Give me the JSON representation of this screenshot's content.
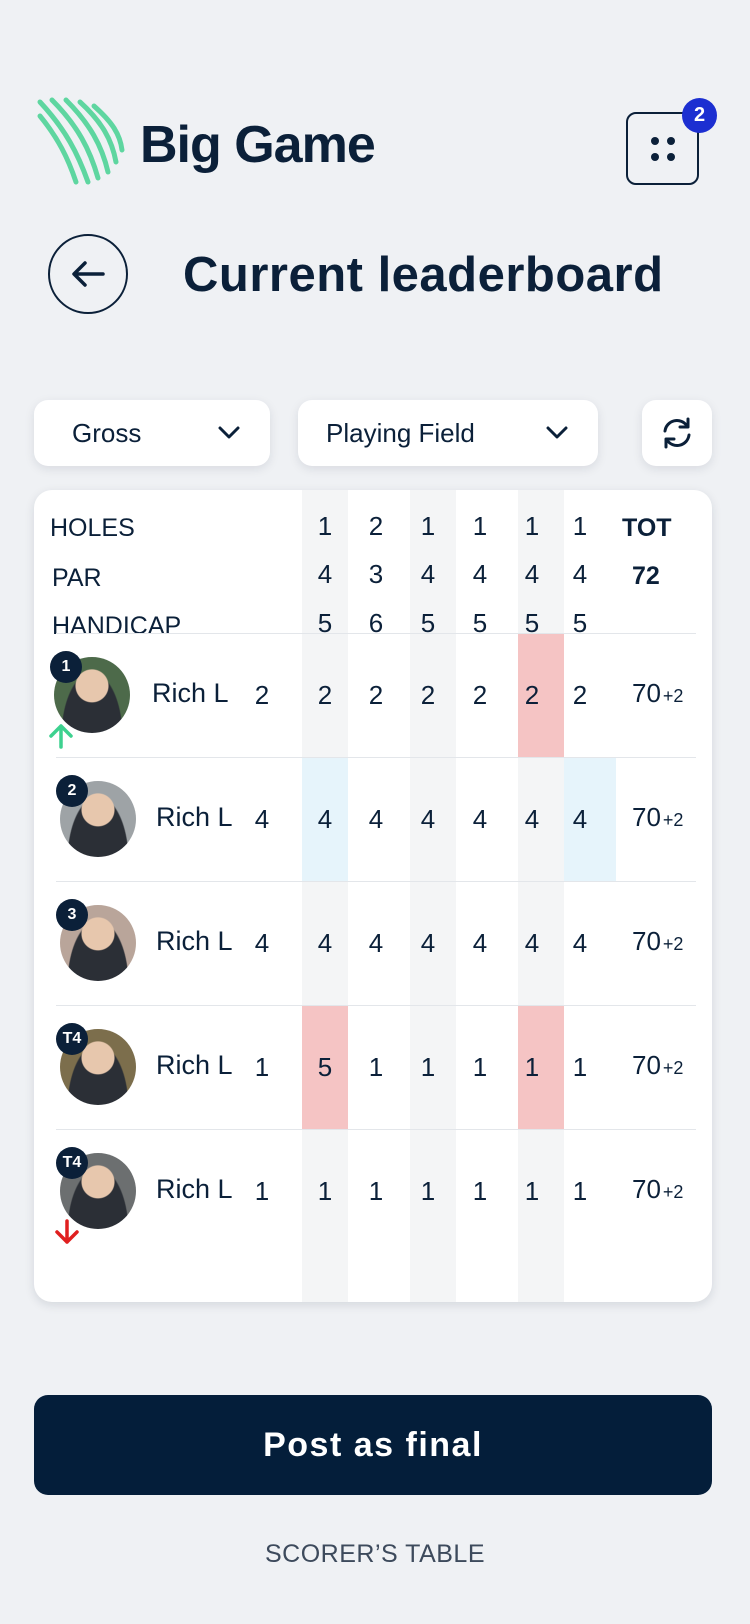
{
  "brand": {
    "name": "Big Game",
    "accent": "#5ed6a0"
  },
  "header": {
    "notification_count": "2",
    "title": "Current leaderboard"
  },
  "filters": {
    "score_type": "Gross",
    "scope": "Playing Field"
  },
  "scorecard": {
    "labels": {
      "holes": "HOLES",
      "par": "PAR",
      "handicap": "HANDICAP",
      "total": "TOT"
    },
    "holes": [
      "1",
      "2",
      "1",
      "1",
      "1",
      "1"
    ],
    "par": [
      "4",
      "3",
      "4",
      "4",
      "4",
      "4"
    ],
    "handicap": [
      "5",
      "6",
      "5",
      "5",
      "5",
      "5"
    ],
    "par_total": "72",
    "players": [
      {
        "rank": "1",
        "name": "Rich L",
        "hcp": "2",
        "scores": [
          "2",
          "2",
          "2",
          "2",
          "2",
          "2"
        ],
        "total": "70",
        "diff": "+2",
        "trend": "up"
      },
      {
        "rank": "2",
        "name": "Rich L",
        "hcp": "4",
        "scores": [
          "4",
          "4",
          "4",
          "4",
          "4",
          "4"
        ],
        "total": "70",
        "diff": "+2",
        "trend": "none"
      },
      {
        "rank": "3",
        "name": "Rich L",
        "hcp": "4",
        "scores": [
          "4",
          "4",
          "4",
          "4",
          "4",
          "4"
        ],
        "total": "70",
        "diff": "+2",
        "trend": "none"
      },
      {
        "rank": "T4",
        "name": "Rich L",
        "hcp": "1",
        "scores": [
          "5",
          "1",
          "1",
          "1",
          "1",
          "1"
        ],
        "total": "70",
        "diff": "+2",
        "trend": "none"
      },
      {
        "rank": "T4",
        "name": "Rich L",
        "hcp": "1",
        "scores": [
          "1",
          "1",
          "1",
          "1",
          "1",
          "1"
        ],
        "total": "70",
        "diff": "+2",
        "trend": "down"
      }
    ]
  },
  "actions": {
    "post_final": "Post as final",
    "scorer_table": "SCORER’S TABLE"
  },
  "colors": {
    "highlight_red": "#f5c4c4",
    "highlight_blue": "#e6f4fb",
    "column_gray": "#f4f5f6",
    "trend_up": "#3dd18f",
    "trend_down": "#e01f1f"
  }
}
